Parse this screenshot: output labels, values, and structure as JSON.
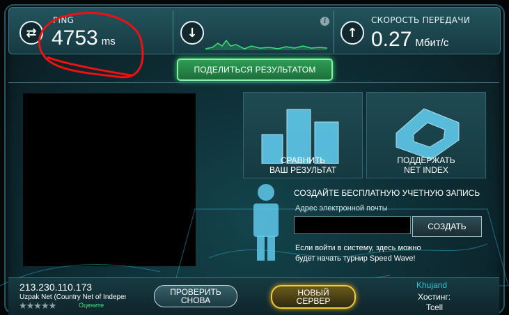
{
  "ping": {
    "label": "PING",
    "value": "4753",
    "unit": "ms"
  },
  "download": {
    "icon": "arrow-down-icon"
  },
  "upload": {
    "label": "СКОРОСТЬ ПЕРЕДАЧИ",
    "value": "0.27",
    "unit": "Мбит/с",
    "icon": "arrow-up-icon"
  },
  "info_icon": "i",
  "share_button": "ПОДЕЛИТЬСЯ РЕЗУЛЬТАТОМ",
  "tiles": [
    {
      "line1": "СРАВНИТЬ",
      "line2": "ВАШ РЕЗУЛЬТАТ"
    },
    {
      "line1": "ПОДДЕРЖАТЬ",
      "line2": "NET INDEX"
    }
  ],
  "signup": {
    "title": "СОЗДАЙТЕ БЕСПЛАТНУЮ УЧЕТНУЮ ЗАПИСЬ",
    "email_label": "Адрес электронной почты",
    "email_value": "",
    "create_button": "СОЗДАТЬ",
    "note": "Если войти в систему, здесь можно будет начать турнир Speed Wave!"
  },
  "footer": {
    "ip": "213.230.110.173",
    "isp": "Uzpak Net (Country Net of Independent",
    "stars": "★★★★★",
    "rate_label": "Оцените",
    "check_again": "ПРОВЕРИТЬ СНОВА",
    "new_server": "НОВЫЙ СЕРВЕР",
    "city": "Khujand",
    "host_label": "Хостинг:",
    "host_name": "Tcell"
  },
  "colors": {
    "accent_green": "#39e86e",
    "accent_gold": "#f2cb3a",
    "link_cyan": "#2fc6d6"
  }
}
